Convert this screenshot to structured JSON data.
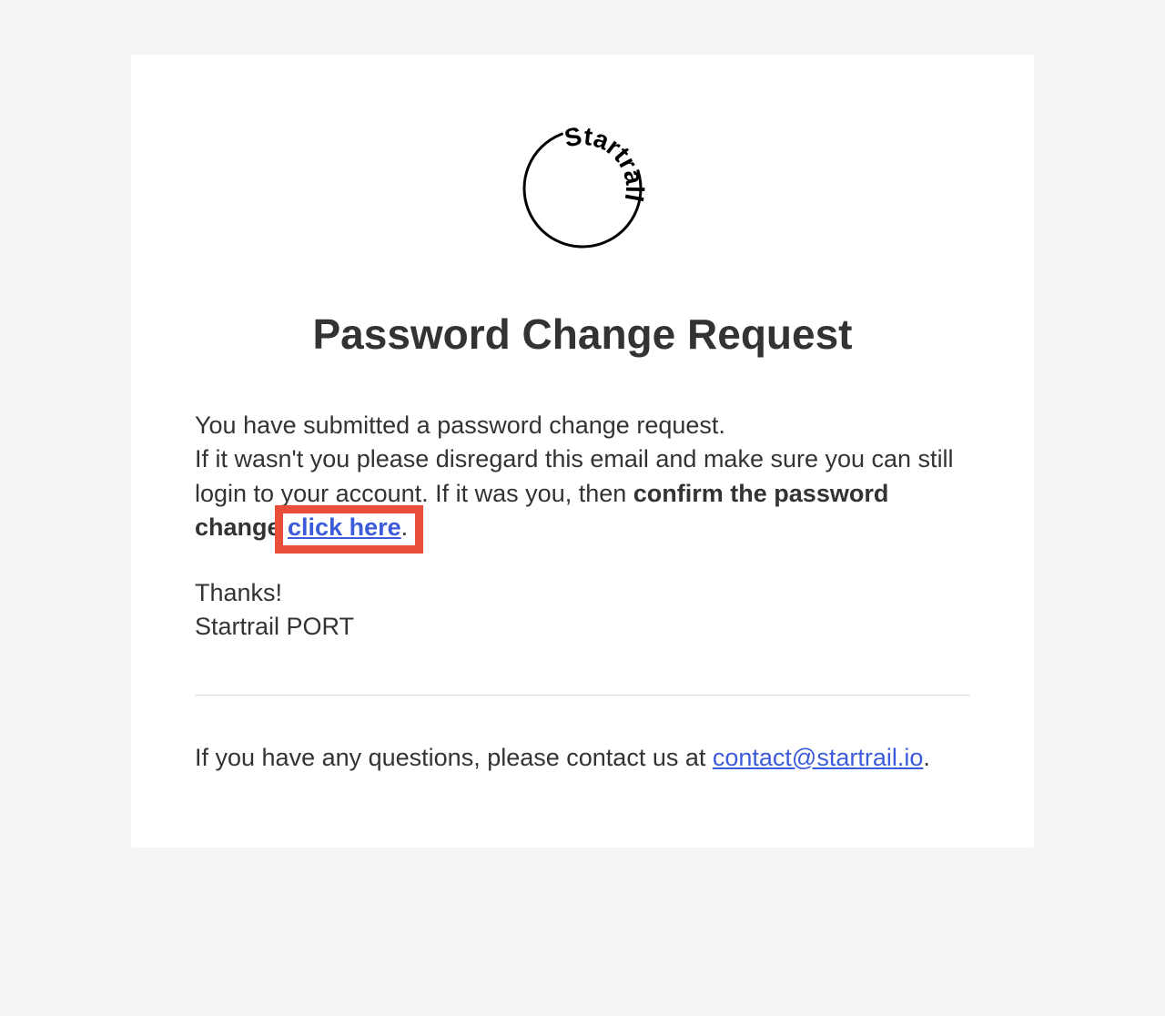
{
  "logo": {
    "brand_text": "Startrail"
  },
  "heading": "Password Change Request",
  "body": {
    "line1": "You have submitted a password change request.",
    "line2_part1": "If it wasn't you please disregard this email and make sure you can still login to your account. If it was you, then ",
    "bold_prefix": "confirm the password change ",
    "link_text": "click here",
    "period": "."
  },
  "signature": {
    "thanks": "Thanks!",
    "sender": "Startrail PORT"
  },
  "footer": {
    "prefix": "If you have any questions, please contact us at ",
    "contact_email": "contact@startrail.io",
    "suffix": "."
  }
}
